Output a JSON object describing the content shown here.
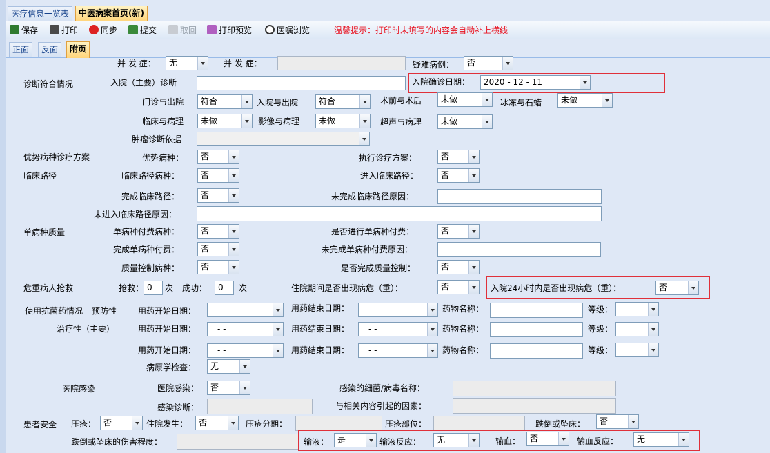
{
  "doc_tabs": [
    {
      "label": "医疗信息一览表",
      "active": false
    },
    {
      "label": "中医病案首页(新)",
      "active": true
    }
  ],
  "toolbar": {
    "buttons": [
      {
        "label": "保存",
        "icon": "save-check-icon",
        "enabled": true
      },
      {
        "label": "打印",
        "icon": "printer-icon",
        "enabled": true
      },
      {
        "label": "同步",
        "icon": "sync-red-x-icon",
        "enabled": true
      },
      {
        "label": "提交",
        "icon": "submit-check-icon",
        "enabled": true
      },
      {
        "label": "取回",
        "icon": "retrieve-icon",
        "enabled": false
      },
      {
        "label": "打印预览",
        "icon": "print-preview-icon",
        "enabled": true
      },
      {
        "label": "医嘱浏览",
        "icon": "magnifier-icon",
        "enabled": true
      }
    ],
    "notice": "温馨提示：打印时未填写的内容会自动补上横线",
    "notice_color": "#e8101e"
  },
  "page_tabs": [
    {
      "label": "正面",
      "active": false
    },
    {
      "label": "反面",
      "active": false
    },
    {
      "label": "附页",
      "active": true
    }
  ],
  "form": {
    "row0": {
      "complication_label1": "并 发 症：",
      "complication_value1": "无",
      "complication_label2": "并 发 症：",
      "complication_value2": "",
      "difficult_label": "疑难病例：",
      "difficult_value": "否"
    },
    "diagnosis": {
      "section": "诊断符合情况",
      "admit_main_label": "入院（主要）诊断",
      "admit_main_value": "",
      "admit_confirm_label": "入院确诊日期：",
      "admit_confirm_value": "2020 - 12 - 11",
      "outpatient_label": "门诊与出院",
      "outpatient_value": "符合",
      "admit_discharge_label": "入院与出院",
      "admit_discharge_value": "符合",
      "preop_label": "术前与术后",
      "preop_value": "未做",
      "frozen_label": "冰冻与石蜡",
      "frozen_value": "未做",
      "clinical_path_label": "临床与病理",
      "clinical_path_value": "未做",
      "imaging_label": "影像与病理",
      "imaging_value": "未做",
      "ultrasound_label": "超声与病理",
      "ultrasound_value": "未做",
      "tumor_label": "肿瘤诊断依据",
      "tumor_value": ""
    },
    "advantage": {
      "section": "优势病种诊疗方案",
      "disease_label": "优势病种：",
      "disease_value": "否",
      "exec_label": "执行诊疗方案：",
      "exec_value": "否"
    },
    "pathway": {
      "section": "临床路径",
      "disease_label": "临床路径病种：",
      "disease_value": "否",
      "enter_label": "进入临床路径：",
      "enter_value": "否",
      "complete_label": "完成临床路径：",
      "complete_value": "否",
      "incomplete_reason_label": "未完成临床路径原因：",
      "incomplete_reason_value": "",
      "not_enter_reason_label": "未进入临床路径原因：",
      "not_enter_reason_value": ""
    },
    "single": {
      "section": "单病种质量",
      "pay_disease_label": "单病种付费病种：",
      "pay_disease_value": "否",
      "pay_done_label": "是否进行单病种付费：",
      "pay_done_value": "否",
      "pay_complete_label": "完成单病种付费：",
      "pay_complete_value": "否",
      "pay_incomplete_label": "未完成单病种付费原因：",
      "pay_incomplete_value": "",
      "qc_disease_label": "质量控制病种：",
      "qc_disease_value": "否",
      "qc_done_label": "是否完成质量控制：",
      "qc_done_value": "否"
    },
    "critical": {
      "section": "危重病人抢救",
      "rescue_label": "抢救：",
      "rescue_value": "0",
      "times1": "次",
      "success_label": "成功：",
      "success_value": "0",
      "times2": "次",
      "during_label": "住院期间是否出现病危（重）：",
      "during_value": "否",
      "within24_label": "入院24小时内是否出现病危（重）：",
      "within24_value": "否"
    },
    "antibiotic": {
      "section": "使用抗菌药情况",
      "preventive": "预防性",
      "therapeutic": "治疗性（主要）",
      "rows": [
        {
          "start_label": "用药开始日期：",
          "start_value": "-   -",
          "end_label": "用药结束日期：",
          "end_value": "-   -",
          "drug_label": "药物名称：",
          "drug_value": "",
          "level_label": "等级：",
          "level_value": ""
        },
        {
          "start_label": "用药开始日期：",
          "start_value": "-   -",
          "end_label": "用药结束日期：",
          "end_value": "-   -",
          "drug_label": "药物名称：",
          "drug_value": "",
          "level_label": "等级：",
          "level_value": ""
        },
        {
          "start_label": "用药开始日期：",
          "start_value": "-   -",
          "end_label": "用药结束日期：",
          "end_value": "-   -",
          "drug_label": "药物名称：",
          "drug_value": "",
          "level_label": "等级：",
          "level_value": ""
        }
      ],
      "pathogen_label": "病原学检查：",
      "pathogen_value": "无"
    },
    "infection": {
      "section": "医院感染",
      "infection_label": "医院感染：",
      "infection_value": "否",
      "bacteria_label": "感染的细菌/病毒名称：",
      "bacteria_value": "",
      "diag_label": "感染诊断：",
      "diag_value": "",
      "factor_label": "与相关内容引起的因素：",
      "factor_value": ""
    },
    "safety": {
      "section": "患者安全",
      "pressure_label": "压疮：",
      "pressure_value": "否",
      "occur_label": "住院发生：",
      "occur_value": "否",
      "stage_label": "压疮分期：",
      "stage_value": "",
      "site_label": "压疮部位：",
      "site_value": "",
      "fall_label": "跌倒或坠床：",
      "fall_value": "否",
      "fall_degree_label": "跌倒或坠床的伤害程度：",
      "fall_degree_value": "",
      "infusion_label": "输液：",
      "infusion_value": "是",
      "infusion_reaction_label": "输液反应：",
      "infusion_reaction_value": "无",
      "transfusion_label": "输血：",
      "transfusion_value": "否",
      "transfusion_reaction_label": "输血反应：",
      "transfusion_reaction_value": "无"
    }
  }
}
